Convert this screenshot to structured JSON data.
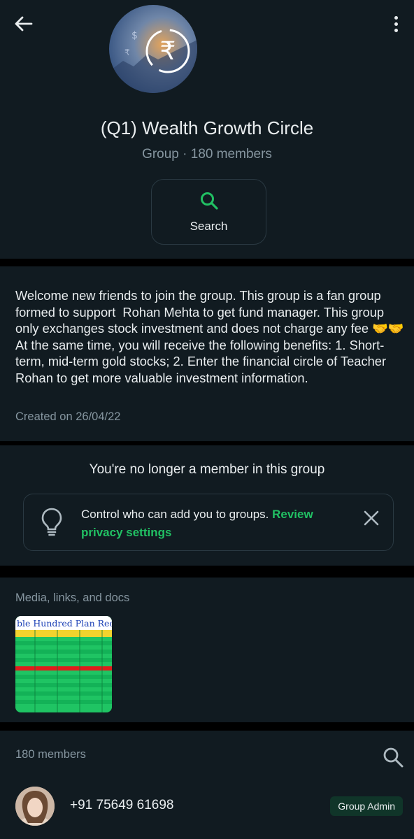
{
  "header": {
    "title": "(Q1) Wealth Growth Circle",
    "subtitle": "Group · 180 members",
    "search_label": "Search"
  },
  "description": {
    "text": "Welcome new friends to join the group. This group is a fan group formed to support  Rohan Mehta to get fund manager. This group only exchanges stock investment and does not charge any fee 🤝🤝\nAt the same time, you will receive the following benefits: 1. Short-term, mid-term gold stocks; 2. Enter the financial circle of Teacher  Rohan to get more valuable investment information.",
    "created": "Created on 26/04/22"
  },
  "membership": {
    "message": "You're no longer a member in this group",
    "privacy_text": "Control who can add you to groups. ",
    "privacy_link": "Review privacy settings"
  },
  "media": {
    "title": "Media, links, and docs",
    "thumb_heading": "ble Hundred Plan Reco"
  },
  "members": {
    "count_label": "180 members",
    "list": [
      {
        "phone": "+91 75649 61698",
        "badge": "Group Admin"
      }
    ]
  },
  "colors": {
    "background": "#111b21",
    "accent": "#21c063",
    "muted": "#8696a0"
  }
}
